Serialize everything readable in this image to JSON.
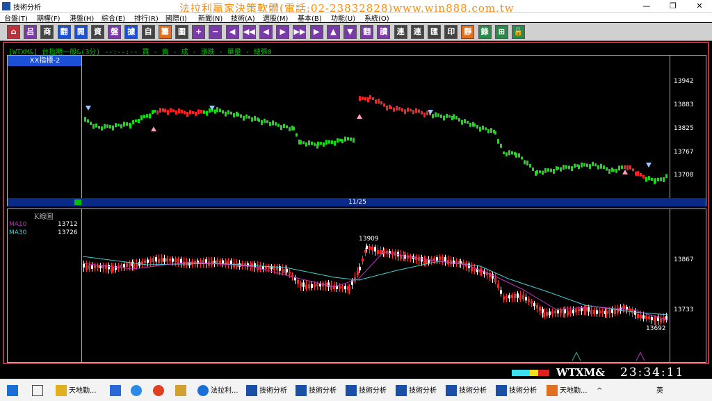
{
  "window": {
    "title": "技術分析",
    "minimize": "—",
    "maximize": "❐",
    "close": "✕"
  },
  "banner": "法拉利贏家決策軟體(電話:02-23832828)www.win888.com.tw",
  "menu": [
    "台盤(T)",
    "期權(F)",
    "港盤(H)",
    "綜合(E)",
    "排行(R)",
    "國際(I)",
    "新聞(N)",
    "技術(A)",
    "選股(M)",
    "基本(B)",
    "功能(U)",
    "系統(O)"
  ],
  "toolbar": {
    "buttons": [
      {
        "label": "⌂",
        "color": "#c0303a"
      },
      {
        "label": "吕",
        "color": "#7a3aa8"
      },
      {
        "label": "商",
        "color": "#444"
      },
      {
        "label": "翻",
        "color": "#1a4fd6"
      },
      {
        "label": "閱",
        "color": "#1a4fd6"
      },
      {
        "label": "資",
        "color": "#444"
      },
      {
        "label": "盤",
        "color": "#7a3aa8"
      },
      {
        "label": "據",
        "color": "#1a4fd6"
      },
      {
        "label": "自",
        "color": "#444"
      },
      {
        "label": "籌",
        "color": "#e07020"
      },
      {
        "label": "圖",
        "color": "#444"
      },
      {
        "label": "+",
        "color": "#7a3aa8"
      },
      {
        "label": "−",
        "color": "#7a3aa8"
      },
      {
        "label": "◀",
        "color": "#7a3aa8"
      },
      {
        "label": "◀◀",
        "color": "#7a3aa8"
      },
      {
        "label": "◀",
        "color": "#7a3aa8"
      },
      {
        "label": "▶",
        "color": "#7a3aa8"
      },
      {
        "label": "▶▶",
        "color": "#7a3aa8"
      },
      {
        "label": "▶",
        "color": "#7a3aa8"
      },
      {
        "label": "▲",
        "color": "#7a3aa8"
      },
      {
        "label": "▼",
        "color": "#7a3aa8"
      },
      {
        "label": "翻",
        "color": "#7a3aa8"
      },
      {
        "label": "讀",
        "color": "#7a3aa8"
      },
      {
        "label": "連",
        "color": "#444"
      },
      {
        "label": "連",
        "color": "#444"
      },
      {
        "label": "匯",
        "color": "#444"
      },
      {
        "label": "印",
        "color": "#444"
      },
      {
        "label": "靜",
        "color": "#e07020"
      },
      {
        "label": "錄",
        "color": "#2a8a4a"
      },
      {
        "label": "⊞",
        "color": "#2a8a4a"
      },
      {
        "label": "🔓",
        "color": "#2a8a4a"
      }
    ]
  },
  "info_line": "[WTXM&] 台指期一般&(3分)  --:--:-- 買 - 賣 - 成 - 漲跌 - 單量 - 總張0",
  "panel1": {
    "tab": "XX指標-2",
    "date_label": "11/25",
    "yticks": [
      "13942",
      "13883",
      "13825",
      "13767",
      "13708"
    ]
  },
  "panel2": {
    "title": "K線圖",
    "ma10": {
      "label": "MA10",
      "value": "13712",
      "color": "#c030c0"
    },
    "ma30": {
      "label": "MA30",
      "value": "13726",
      "color": "#40d0d0"
    },
    "yticks": [
      "13867",
      "13733"
    ],
    "high_label": "13909",
    "low_label": "13692"
  },
  "status": {
    "symbol": "WTXM&",
    "time": "23:34:11"
  },
  "taskbar": {
    "items": [
      "天地勤...",
      "法拉利...",
      "技術分析",
      "技術分析",
      "技術分析",
      "技術分析",
      "技術分析",
      "技術分析",
      "天地勤..."
    ],
    "ime": "英"
  }
}
